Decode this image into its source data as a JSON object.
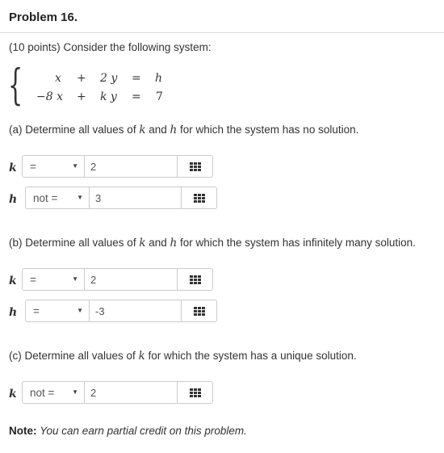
{
  "problem": {
    "title": "Problem 16.",
    "intro": "(10 points) Consider the following system:"
  },
  "system": {
    "row1": {
      "a": "x",
      "op": "+",
      "b": "2 y",
      "eq": "=",
      "rhs": "h"
    },
    "row2": {
      "a": "−8 x",
      "op": "+",
      "b": "k y",
      "eq": "=",
      "rhs": "7"
    }
  },
  "part_a": {
    "pre": "(a) Determine all values of ",
    "k": "k",
    "and": " and ",
    "h": "h",
    "post": " for which the system has no solution.",
    "rows": [
      {
        "var": "k",
        "relation": "=",
        "value": "2"
      },
      {
        "var": "h",
        "relation": "not =",
        "value": "3"
      }
    ]
  },
  "part_b": {
    "pre": "(b) Determine all values of ",
    "k": "k",
    "and": " and ",
    "h": "h",
    "post": " for which the system has infinitely many solution.",
    "rows": [
      {
        "var": "k",
        "relation": "=",
        "value": "2"
      },
      {
        "var": "h",
        "relation": "=",
        "value": "-3"
      }
    ]
  },
  "part_c": {
    "pre": "(c) Determine all values of ",
    "k": "k",
    "post": " for which the system has a unique solution.",
    "rows": [
      {
        "var": "k",
        "relation": "not =",
        "value": "2"
      }
    ]
  },
  "note": {
    "label": "Note:",
    "text": "You can earn partial credit on this problem."
  },
  "icons": {
    "equation_editor": "grid-icon",
    "dropdown": "caret-down-icon"
  }
}
